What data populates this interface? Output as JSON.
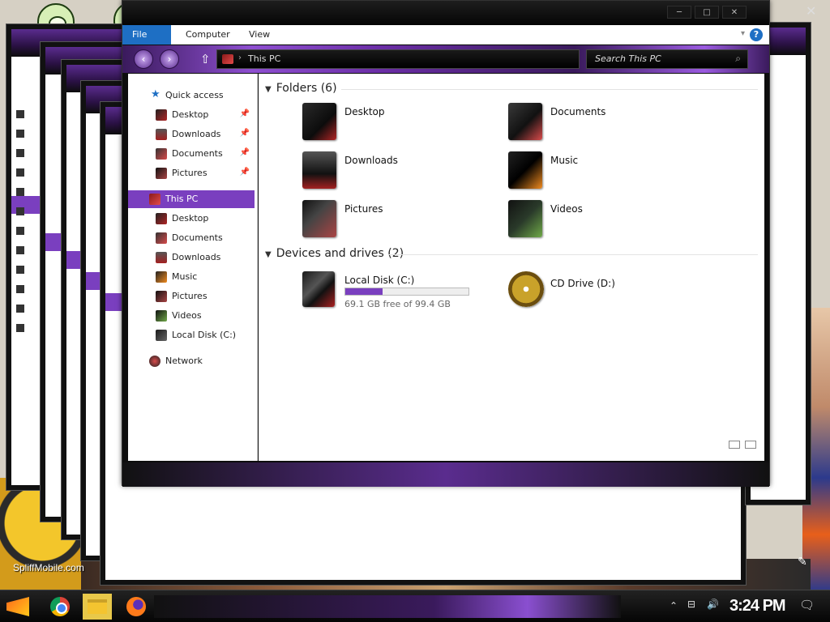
{
  "window": {
    "title": "This PC"
  },
  "ribbon": {
    "tabs": [
      "File",
      "Computer",
      "View"
    ]
  },
  "address": {
    "location": "This PC"
  },
  "search": {
    "placeholder": "Search This PC"
  },
  "nav_pane": {
    "quick_access": "Quick access",
    "quick_items": [
      "Desktop",
      "Downloads",
      "Documents",
      "Pictures"
    ],
    "this_pc": "This PC",
    "pc_items": [
      "Desktop",
      "Documents",
      "Downloads",
      "Music",
      "Pictures",
      "Videos",
      "Local Disk (C:)"
    ],
    "network": "Network"
  },
  "content": {
    "folders_header": "Folders (6)",
    "folders": [
      "Desktop",
      "Documents",
      "Downloads",
      "Music",
      "Pictures",
      "Videos"
    ],
    "devices_header": "Devices and drives (2)",
    "drives": [
      {
        "name": "Local Disk (C:)",
        "free": "69.1 GB free of 99.4 GB",
        "used_fraction": 0.305
      },
      {
        "name": "CD Drive (D:)"
      }
    ]
  },
  "desktop": {
    "watermark": "SpliffMobile.com"
  },
  "taskbar": {
    "clock": "3:24 PM",
    "apps": [
      "Google Chrome",
      "File Explorer",
      "Firefox"
    ]
  },
  "icons": [
    "pin-icon",
    "search-icon",
    "help-icon",
    "up-arrow-icon",
    "chevron-down-icon",
    "notification-icon",
    "speaker-icon",
    "network-tray-icon"
  ],
  "colors": {
    "accent": "#7a3fbf",
    "ribbon_file": "#1e6fc4",
    "drive_bar": "#7a3fbf"
  }
}
